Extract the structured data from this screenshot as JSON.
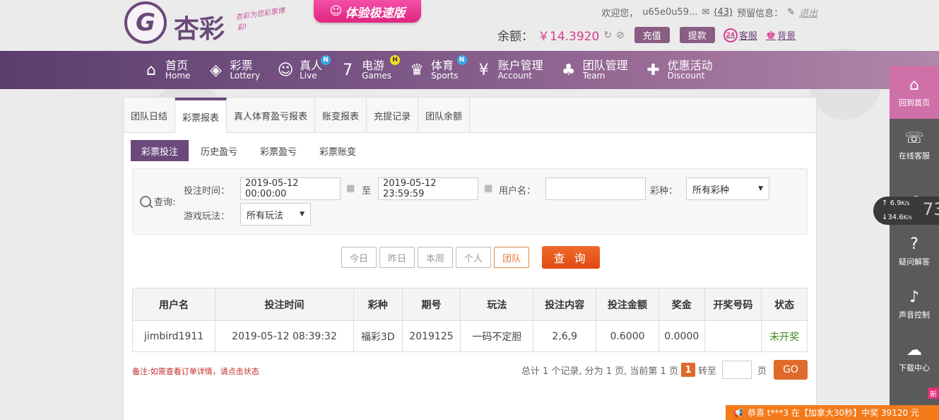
{
  "header": {
    "logo_text": "杏彩",
    "logo_slogan": "杏彩为您彩票博彩!",
    "fast_version": "体验极速版",
    "welcome": "欢迎您，",
    "username": "u65e0u59...",
    "mail_count": "(43)",
    "notice": "预留信息：",
    "logout": "退出",
    "balance_label": "余额：",
    "balance_value": "￥14.3920",
    "deposit": "充值",
    "withdraw": "提款",
    "support": "客服",
    "background": "背景",
    "support_badge": "24"
  },
  "nav": [
    {
      "cn": "首页",
      "en": "Home",
      "icon": "home-icon",
      "glyph": "⌂",
      "badge": ""
    },
    {
      "cn": "彩票",
      "en": "Lottery",
      "icon": "ticket-icon",
      "glyph": "◈",
      "badge": ""
    },
    {
      "cn": "真人",
      "en": "Live",
      "icon": "live-dealer-icon",
      "glyph": "☺",
      "badge": "N"
    },
    {
      "cn": "电游",
      "en": "Games",
      "icon": "slot-seven-icon",
      "glyph": "7",
      "badge": "H"
    },
    {
      "cn": "体育",
      "en": "Sports",
      "icon": "trophy-icon",
      "glyph": "♛",
      "badge": "N"
    },
    {
      "cn": "账户管理",
      "en": "Account",
      "icon": "account-yen-icon",
      "glyph": "¥",
      "badge": ""
    },
    {
      "cn": "团队管理",
      "en": "Team",
      "icon": "team-icon",
      "glyph": "♣",
      "badge": ""
    },
    {
      "cn": "优惠活动",
      "en": "Discount",
      "icon": "gift-icon",
      "glyph": "✚",
      "badge": ""
    }
  ],
  "tabs": [
    "团队日结",
    "彩票报表",
    "真人体育盈亏报表",
    "账变报表",
    "充提记录",
    "团队余额"
  ],
  "active_tab": 1,
  "subtabs": [
    "彩票投注",
    "历史盈亏",
    "彩票盈亏",
    "彩票账变"
  ],
  "filter": {
    "query_label": "查询:",
    "bet_time_label": "投注时间：",
    "start_time": "2019-05-12 00:00:00",
    "to": "至",
    "end_time": "2019-05-12 23:59:59",
    "username_label": "用户名：",
    "username_value": "",
    "lottery_label": "彩种：",
    "lottery_value": "所有彩种",
    "play_label": "游戏玩法：",
    "play_value": "所有玩法"
  },
  "quick_buttons": [
    "今日",
    "昨日",
    "本周",
    "个人",
    "团队"
  ],
  "search_button": "查 询",
  "table": {
    "headers": [
      "用户名",
      "投注时间",
      "彩种",
      "期号",
      "玩法",
      "投注内容",
      "投注金额",
      "奖金",
      "开奖号码",
      "状态"
    ],
    "rows": [
      [
        "jimbird1911",
        "2019-05-12 08:39:32",
        "福彩3D",
        "2019125",
        "一码不定胆",
        "2,6,9",
        "0.6000",
        "0.0000",
        "",
        "未开奖"
      ]
    ]
  },
  "note": "备注:如需查看订单详情，请点击状态",
  "pager": {
    "summary": "总计 1 个记录, 分为 1 页, 当前第 1 页",
    "current": "1",
    "goto": "转至",
    "page_unit": "页",
    "go": "GO"
  },
  "sidebar": [
    {
      "label": "回到首页",
      "icon": "home-icon",
      "glyph": "⌂"
    },
    {
      "label": "在线客服",
      "icon": "headset-icon",
      "glyph": "☏"
    },
    {
      "label": "",
      "icon": "chat-icon",
      "glyph": "☁"
    },
    {
      "label": "疑问解答",
      "icon": "question-icon",
      "glyph": "?"
    },
    {
      "label": "声音控制",
      "icon": "speaker-icon",
      "glyph": "♪"
    },
    {
      "label": "下载中心",
      "icon": "download-icon",
      "glyph": "☁"
    }
  ],
  "speed": {
    "up": "6.9",
    "up_unit": "K/s",
    "down": "34.6",
    "down_unit": "K/s",
    "big": "73"
  },
  "ticker": "恭喜 t***3 在【加拿大30秒】中奖 39120 元",
  "new_badge": "新",
  "colors": {
    "nav_start": "#5a3e6e",
    "accent": "#6a4a7a",
    "pink": "#d83e8a",
    "orange": "#e06a2a"
  }
}
